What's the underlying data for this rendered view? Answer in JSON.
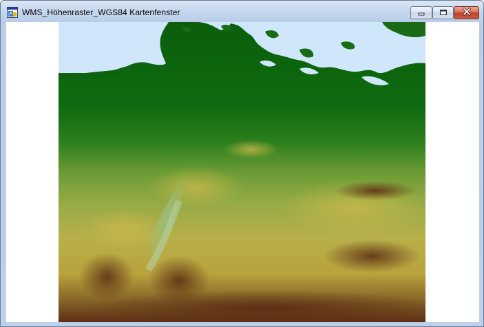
{
  "window": {
    "title": "WMS_Höhenraster_WGS84 Kartenfenster",
    "icon": "map-window-icon"
  },
  "controls": {
    "minimize_icon": "minimize-icon",
    "maximize_icon": "maximize-icon",
    "close_icon": "close-icon"
  },
  "map": {
    "layer": "elevation-raster",
    "colors": {
      "water": "#cfe6fb",
      "lowland": "#0e6b10",
      "midland": "#86a83a",
      "upland": "#c8b43e",
      "highland": "#6f3a1b",
      "background": "#ffffff"
    }
  }
}
